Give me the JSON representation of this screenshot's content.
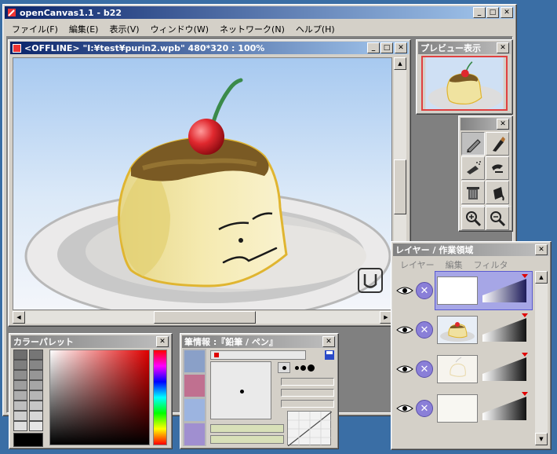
{
  "app": {
    "title": "openCanvas1.1 - b22",
    "menu": [
      "ファイル(F)",
      "編集(E)",
      "表示(V)",
      "ウィンドウ(W)",
      "ネットワーク(N)",
      "ヘルプ(H)"
    ]
  },
  "document": {
    "title": "<OFFLINE> \"I:¥test¥purin2.wpb\" 480*320 : 100%"
  },
  "preview": {
    "title": "プレビュー表示"
  },
  "tools": {
    "icons": [
      "pencil-icon",
      "brush-icon",
      "airbrush-icon",
      "smudge-icon",
      "trash-icon",
      "bucket-icon",
      "move-icon",
      "eyedropper-icon",
      "zoom-in-icon",
      "zoom-out-icon"
    ]
  },
  "palette": {
    "title": "カラーパレット",
    "swatches": [
      "#6e6e6e",
      "#8a8a8a",
      "#9a9a9a",
      "#a8a8a8",
      "#b4b4b4",
      "#c0c0c0",
      "#cccccc",
      "#d8d8d8",
      "#000000"
    ]
  },
  "brush": {
    "title": "筆情報 :『鉛筆 / ペン』"
  },
  "layers": {
    "title": "レイヤー / 作業領域",
    "menu": [
      "レイヤー",
      "編集",
      "フィルタ"
    ],
    "rows": [
      "layer-1",
      "layer-2",
      "layer-3",
      "layer-4"
    ]
  },
  "colors": {
    "title_active": "#0a246a",
    "selection": "#a6a6e6",
    "accent_red": "#e00000"
  }
}
